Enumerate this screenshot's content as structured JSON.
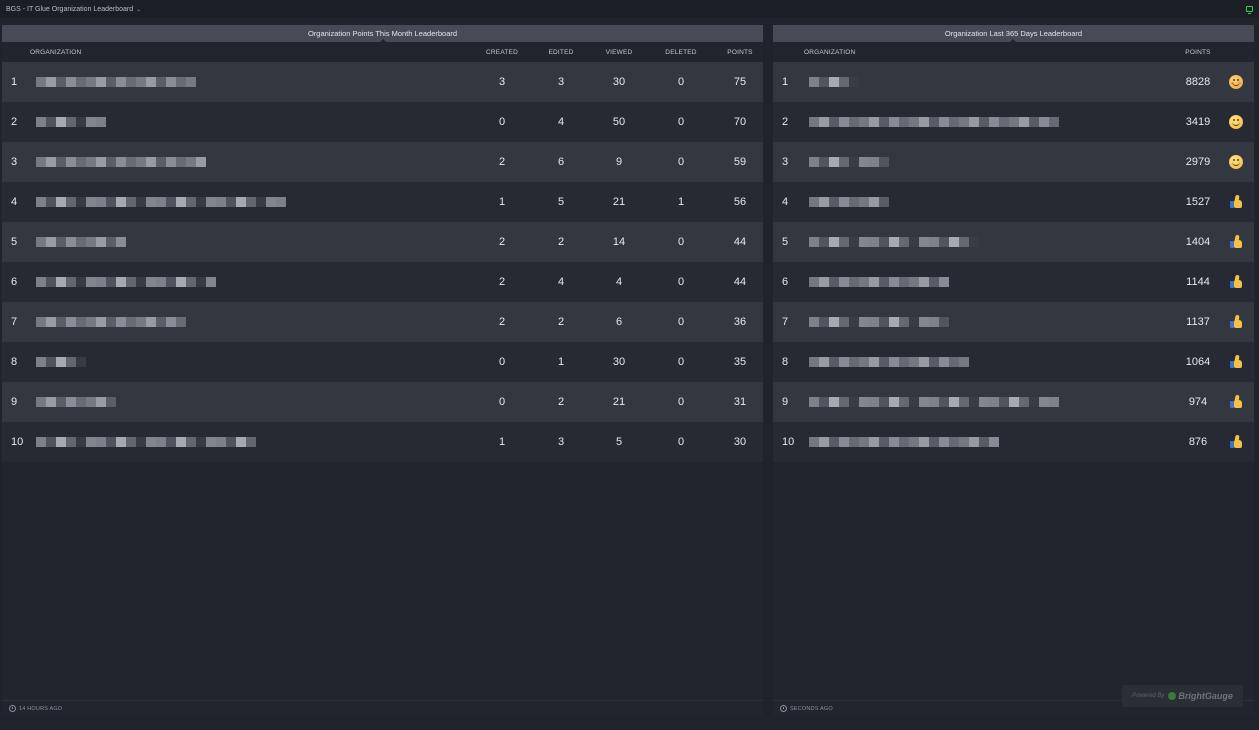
{
  "app": {
    "title": "BGS - IT Glue Organization Leaderboard"
  },
  "left_panel": {
    "title": "Organization Points This Month Leaderboard",
    "columns": [
      "ORGANIZATION",
      "CREATED",
      "EDITED",
      "VIEWED",
      "DELETED",
      "POINTS"
    ],
    "rows": [
      {
        "rank": "1",
        "created": "3",
        "edited": "3",
        "viewed": "30",
        "deleted": "0",
        "points": "75"
      },
      {
        "rank": "2",
        "created": "0",
        "edited": "4",
        "viewed": "50",
        "deleted": "0",
        "points": "70"
      },
      {
        "rank": "3",
        "created": "2",
        "edited": "6",
        "viewed": "9",
        "deleted": "0",
        "points": "59"
      },
      {
        "rank": "4",
        "created": "1",
        "edited": "5",
        "viewed": "21",
        "deleted": "1",
        "points": "56"
      },
      {
        "rank": "5",
        "created": "2",
        "edited": "2",
        "viewed": "14",
        "deleted": "0",
        "points": "44"
      },
      {
        "rank": "6",
        "created": "2",
        "edited": "4",
        "viewed": "4",
        "deleted": "0",
        "points": "44"
      },
      {
        "rank": "7",
        "created": "2",
        "edited": "2",
        "viewed": "6",
        "deleted": "0",
        "points": "36"
      },
      {
        "rank": "8",
        "created": "0",
        "edited": "1",
        "viewed": "30",
        "deleted": "0",
        "points": "35"
      },
      {
        "rank": "9",
        "created": "0",
        "edited": "2",
        "viewed": "21",
        "deleted": "0",
        "points": "31"
      },
      {
        "rank": "10",
        "created": "1",
        "edited": "3",
        "viewed": "5",
        "deleted": "0",
        "points": "30"
      }
    ],
    "updated": "14 HOURS AGO"
  },
  "right_panel": {
    "title": "Organization Last 365 Days Leaderboard",
    "columns": [
      "ORGANIZATION",
      "POINTS"
    ],
    "rows": [
      {
        "rank": "1",
        "points": "8828",
        "icon": "smile-blush-emoji-icon"
      },
      {
        "rank": "2",
        "points": "3419",
        "icon": "smile-emoji-icon"
      },
      {
        "rank": "3",
        "points": "2979",
        "icon": "smile-emoji-icon"
      },
      {
        "rank": "4",
        "points": "1527",
        "icon": "thumbs-up-icon"
      },
      {
        "rank": "5",
        "points": "1404",
        "icon": "thumbs-up-icon"
      },
      {
        "rank": "6",
        "points": "1144",
        "icon": "thumbs-up-icon"
      },
      {
        "rank": "7",
        "points": "1137",
        "icon": "thumbs-up-icon"
      },
      {
        "rank": "8",
        "points": "1064",
        "icon": "thumbs-up-icon"
      },
      {
        "rank": "9",
        "points": "974",
        "icon": "thumbs-up-icon"
      },
      {
        "rank": "10",
        "points": "876",
        "icon": "thumbs-up-icon"
      }
    ],
    "updated": "SECONDS AGO"
  },
  "powered_by": {
    "label": "Powered By",
    "brand": "BrightGauge"
  },
  "colors": {
    "background": "#1f232b",
    "panel_header": "#474b55",
    "row_odd": "#333740",
    "row_even": "#262a32",
    "status_green": "#2fd14a"
  }
}
